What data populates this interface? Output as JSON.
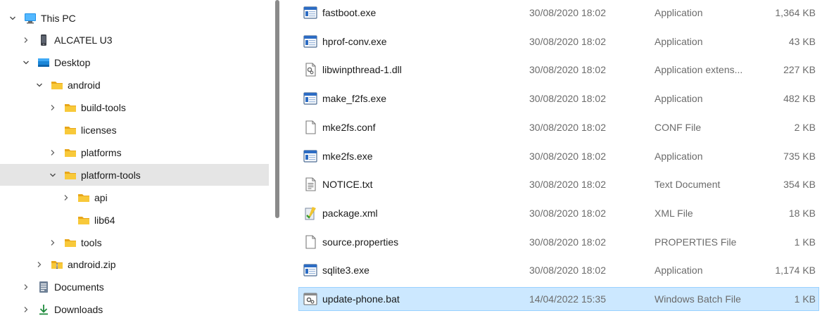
{
  "nav": {
    "items": [
      {
        "label": "This PC",
        "icon": "computer-icon",
        "expander": "expanded",
        "indent": 0
      },
      {
        "label": "ALCATEL U3",
        "icon": "phone-icon",
        "expander": "collapsed",
        "indent": 1
      },
      {
        "label": "Desktop",
        "icon": "desktop-icon",
        "expander": "expanded",
        "indent": 1
      },
      {
        "label": "android",
        "icon": "folder-icon",
        "expander": "expanded",
        "indent": 2
      },
      {
        "label": "build-tools",
        "icon": "folder-icon",
        "expander": "collapsed",
        "indent": 3
      },
      {
        "label": "licenses",
        "icon": "folder-icon",
        "expander": "none",
        "indent": 3
      },
      {
        "label": "platforms",
        "icon": "folder-icon",
        "expander": "collapsed",
        "indent": 3
      },
      {
        "label": "platform-tools",
        "icon": "folder-icon",
        "expander": "expanded",
        "indent": 3,
        "selected": true
      },
      {
        "label": "api",
        "icon": "folder-icon",
        "expander": "collapsed",
        "indent": 4
      },
      {
        "label": "lib64",
        "icon": "folder-icon",
        "expander": "none",
        "indent": 4
      },
      {
        "label": "tools",
        "icon": "folder-icon",
        "expander": "collapsed",
        "indent": 3
      },
      {
        "label": "android.zip",
        "icon": "zip-folder-icon",
        "expander": "collapsed",
        "indent": 2
      },
      {
        "label": "Documents",
        "icon": "documents-icon",
        "expander": "collapsed",
        "indent": 1
      },
      {
        "label": "Downloads",
        "icon": "downloads-icon",
        "expander": "collapsed",
        "indent": 1
      }
    ]
  },
  "files": {
    "rows": [
      {
        "name": "fastboot.exe",
        "date": "30/08/2020 18:02",
        "type": "Application",
        "size": "1,364 KB",
        "icon": "application-icon"
      },
      {
        "name": "hprof-conv.exe",
        "date": "30/08/2020 18:02",
        "type": "Application",
        "size": "43 KB",
        "icon": "application-icon"
      },
      {
        "name": "libwinpthread-1.dll",
        "date": "30/08/2020 18:02",
        "type": "Application extens...",
        "size": "227 KB",
        "icon": "dll-icon"
      },
      {
        "name": "make_f2fs.exe",
        "date": "30/08/2020 18:02",
        "type": "Application",
        "size": "482 KB",
        "icon": "application-icon"
      },
      {
        "name": "mke2fs.conf",
        "date": "30/08/2020 18:02",
        "type": "CONF File",
        "size": "2 KB",
        "icon": "blank-file-icon"
      },
      {
        "name": "mke2fs.exe",
        "date": "30/08/2020 18:02",
        "type": "Application",
        "size": "735 KB",
        "icon": "application-icon"
      },
      {
        "name": "NOTICE.txt",
        "date": "30/08/2020 18:02",
        "type": "Text Document",
        "size": "354 KB",
        "icon": "text-file-icon"
      },
      {
        "name": "package.xml",
        "date": "30/08/2020 18:02",
        "type": "XML File",
        "size": "18 KB",
        "icon": "xml-file-icon"
      },
      {
        "name": "source.properties",
        "date": "30/08/2020 18:02",
        "type": "PROPERTIES File",
        "size": "1 KB",
        "icon": "blank-file-icon"
      },
      {
        "name": "sqlite3.exe",
        "date": "30/08/2020 18:02",
        "type": "Application",
        "size": "1,174 KB",
        "icon": "application-icon"
      },
      {
        "name": "update-phone.bat",
        "date": "14/04/2022 15:35",
        "type": "Windows Batch File",
        "size": "1 KB",
        "icon": "batch-file-icon",
        "selected": true
      }
    ]
  },
  "colors": {
    "folder": "#f8c93a",
    "selected_nav_bg": "#e5e5e5",
    "selected_row_bg": "#cce8ff",
    "selected_row_border": "#99d1ff",
    "accent": "#0078d4"
  }
}
